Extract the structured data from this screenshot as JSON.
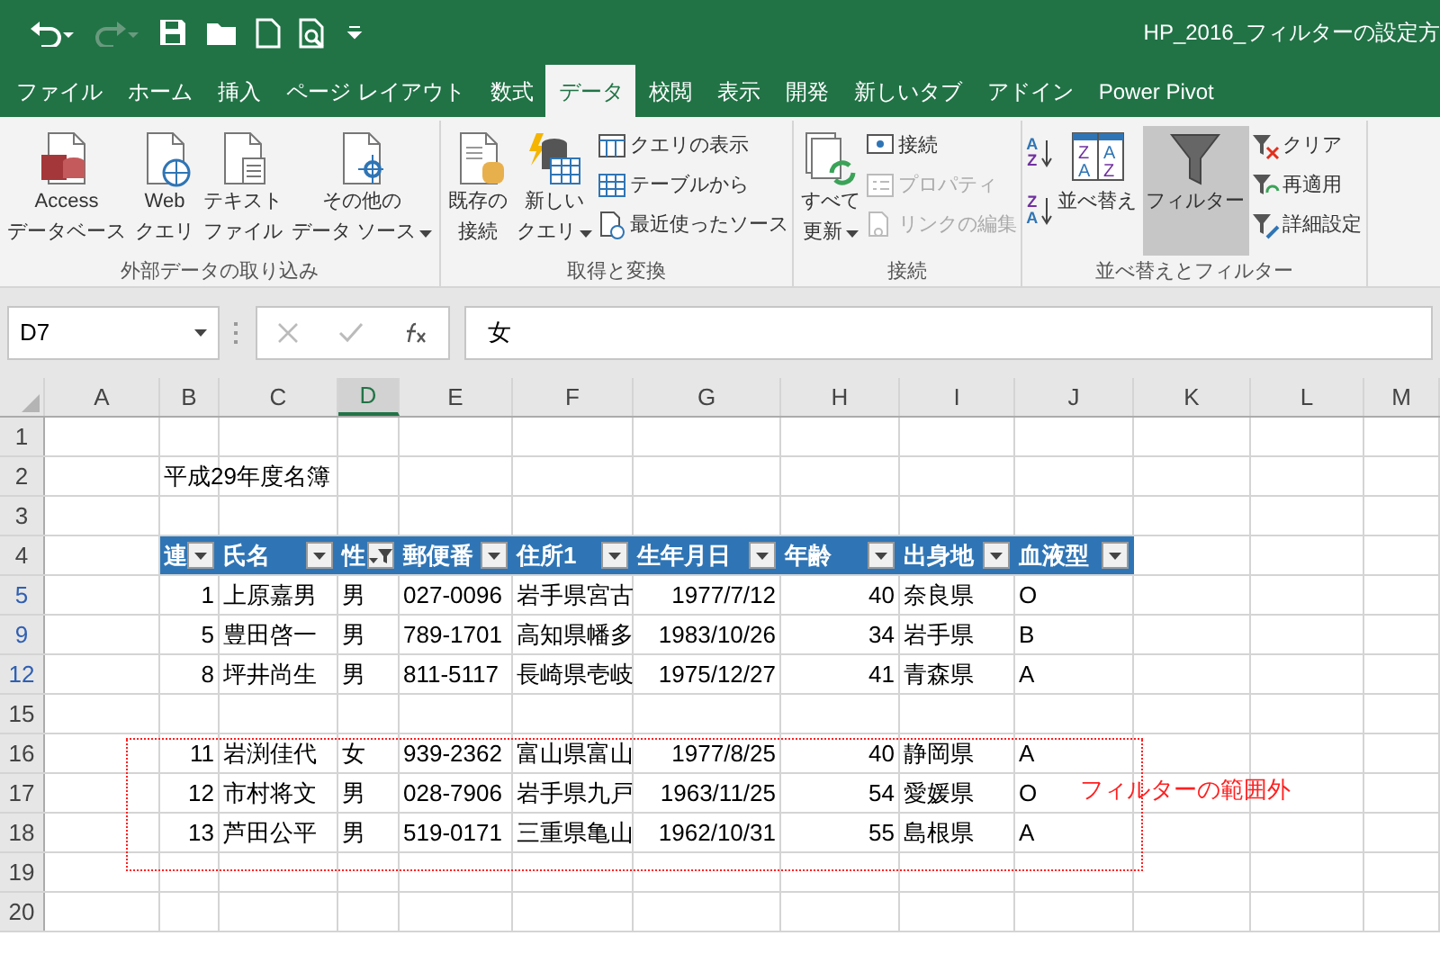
{
  "title_bar": {
    "title": "HP_2016_フィルターの設定方",
    "quick_access": [
      {
        "kind": "undo",
        "disabled": false
      },
      {
        "kind": "redo",
        "disabled": true
      },
      {
        "kind": "save",
        "disabled": false
      },
      {
        "kind": "open",
        "disabled": false
      },
      {
        "kind": "new",
        "disabled": false
      },
      {
        "kind": "preview",
        "disabled": false
      },
      {
        "kind": "customize",
        "disabled": false
      }
    ]
  },
  "tabs": [
    {
      "label": "ファイル",
      "selected": false
    },
    {
      "label": "ホーム",
      "selected": false
    },
    {
      "label": "挿入",
      "selected": false
    },
    {
      "label": "ページ レイアウト",
      "selected": false
    },
    {
      "label": "数式",
      "selected": false
    },
    {
      "label": "データ",
      "selected": true
    },
    {
      "label": "校閲",
      "selected": false
    },
    {
      "label": "表示",
      "selected": false
    },
    {
      "label": "開発",
      "selected": false
    },
    {
      "label": "新しいタブ",
      "selected": false
    },
    {
      "label": "アドイン",
      "selected": false
    },
    {
      "label": "Power Pivot",
      "selected": false
    }
  ],
  "ribbon": {
    "groups": [
      {
        "label": "外部データの取り込み",
        "buttons": [
          {
            "lines": [
              "Access",
              "データベース"
            ],
            "dropdown": false
          },
          {
            "lines": [
              "Web",
              "クエリ"
            ],
            "dropdown": false
          },
          {
            "lines": [
              "テキスト",
              "ファイル"
            ],
            "dropdown": false
          },
          {
            "lines": [
              "その他の",
              "データ ソース"
            ],
            "dropdown": true
          }
        ]
      },
      {
        "label": "取得と変換",
        "buttons": [
          {
            "lines": [
              "既存の",
              "接続"
            ],
            "dropdown": false
          },
          {
            "lines": [
              "新しい",
              "クエリ"
            ],
            "dropdown": true
          }
        ],
        "small": [
          {
            "label": "クエリの表示",
            "disabled": false
          },
          {
            "label": "テーブルから",
            "disabled": false
          },
          {
            "label": "最近使ったソース",
            "disabled": false
          }
        ]
      },
      {
        "label": "接続",
        "buttons": [
          {
            "lines": [
              "すべて",
              "更新"
            ],
            "dropdown": true
          }
        ],
        "small": [
          {
            "label": "接続",
            "disabled": false
          },
          {
            "label": "プロパティ",
            "disabled": true
          },
          {
            "label": "リンクの編集",
            "disabled": true
          }
        ]
      },
      {
        "label": "並べ替えとフィルター",
        "sort_icons": [
          [
            "A",
            "Z"
          ],
          [
            "Z",
            "A"
          ]
        ],
        "sort_dialog_letters": [
          "Z",
          "A",
          "A",
          "Z"
        ],
        "buttons": [
          {
            "lines": [
              "並べ替え"
            ],
            "dropdown": false,
            "on": false
          },
          {
            "lines": [
              "フィルター"
            ],
            "dropdown": false,
            "on": true
          }
        ],
        "small": [
          {
            "label": "クリア",
            "disabled": false
          },
          {
            "label": "再適用",
            "disabled": false
          },
          {
            "label": "詳細設定",
            "disabled": false
          }
        ]
      }
    ]
  },
  "formula_bar": {
    "name_box": "D7",
    "formula": "女"
  },
  "columns": [
    {
      "label": "A",
      "selected": false
    },
    {
      "label": "B",
      "selected": false
    },
    {
      "label": "C",
      "selected": false
    },
    {
      "label": "D",
      "selected": true
    },
    {
      "label": "E",
      "selected": false
    },
    {
      "label": "F",
      "selected": false
    },
    {
      "label": "G",
      "selected": false
    },
    {
      "label": "H",
      "selected": false
    },
    {
      "label": "I",
      "selected": false
    },
    {
      "label": "J",
      "selected": false
    },
    {
      "label": "K",
      "selected": false
    },
    {
      "label": "L",
      "selected": false
    },
    {
      "label": "M",
      "selected": false
    }
  ],
  "rows": [
    {
      "number": "1",
      "filtered": false,
      "kind": "blank"
    },
    {
      "number": "2",
      "filtered": false,
      "kind": "title",
      "text": "平成29年度名簿"
    },
    {
      "number": "3",
      "filtered": false,
      "kind": "blank"
    },
    {
      "number": "4",
      "filtered": false,
      "kind": "header",
      "headers": [
        {
          "label": "連",
          "filter_active": false
        },
        {
          "label": "氏名",
          "filter_active": false
        },
        {
          "label": "性",
          "filter_active": true
        },
        {
          "label": "郵便番",
          "filter_active": false
        },
        {
          "label": "住所1",
          "filter_active": false
        },
        {
          "label": "生年月日",
          "filter_active": false
        },
        {
          "label": "年齢",
          "filter_active": false
        },
        {
          "label": "出身地",
          "filter_active": false
        },
        {
          "label": "血液型",
          "filter_active": false
        }
      ]
    },
    {
      "number": "5",
      "filtered": true,
      "kind": "data",
      "values": [
        "1",
        "上原嘉男",
        "男",
        "027-0096",
        "岩手県宮古",
        "1977/7/12",
        "40",
        "奈良県",
        "O"
      ]
    },
    {
      "number": "9",
      "filtered": true,
      "kind": "data",
      "values": [
        "5",
        "豊田啓一",
        "男",
        "789-1701",
        "高知県幡多",
        "1983/10/26",
        "34",
        "岩手県",
        "B"
      ]
    },
    {
      "number": "12",
      "filtered": true,
      "kind": "data",
      "values": [
        "8",
        "坪井尚生",
        "男",
        "811-5117",
        "長崎県壱岐",
        "1975/12/27",
        "41",
        "青森県",
        "A"
      ]
    },
    {
      "number": "15",
      "filtered": false,
      "kind": "blank"
    },
    {
      "number": "16",
      "filtered": false,
      "kind": "data",
      "values": [
        "11",
        "岩渕佳代",
        "女",
        "939-2362",
        "富山県富山",
        "1977/8/25",
        "40",
        "静岡県",
        "A"
      ]
    },
    {
      "number": "17",
      "filtered": false,
      "kind": "data",
      "values": [
        "12",
        "市村将文",
        "男",
        "028-7906",
        "岩手県九戸",
        "1963/11/25",
        "54",
        "愛媛県",
        "O"
      ]
    },
    {
      "number": "18",
      "filtered": false,
      "kind": "data",
      "values": [
        "13",
        "芦田公平",
        "男",
        "519-0171",
        "三重県亀山",
        "1962/10/31",
        "55",
        "島根県",
        "A"
      ]
    },
    {
      "number": "19",
      "filtered": false,
      "kind": "blank"
    },
    {
      "number": "20",
      "filtered": false,
      "kind": "blank"
    }
  ],
  "annotation": {
    "text": "フィルターの範囲外"
  }
}
